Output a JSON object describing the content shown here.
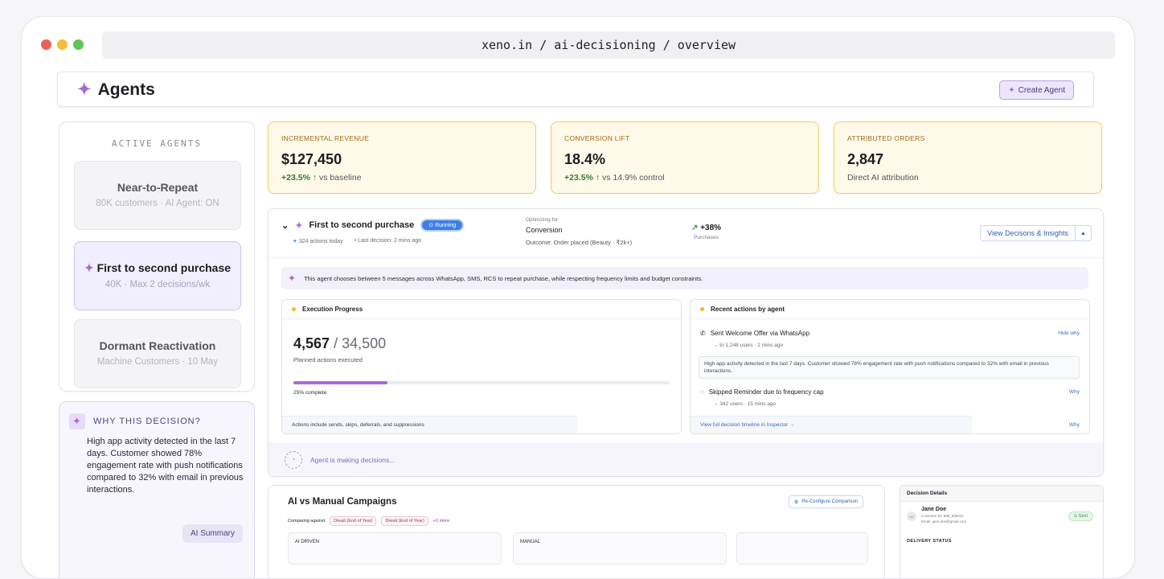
{
  "browser": {
    "url": "xeno.in / ai-decisioning / overview",
    "dots": [
      "#ec5f57",
      "#f5bd3a",
      "#5fc454"
    ]
  },
  "header": {
    "title": "Agents",
    "create_label": "Create Agent"
  },
  "sidebar": {
    "label": "ACTIVE AGENTS",
    "agents": [
      {
        "name": "Near-to-Repeat",
        "sub": "80K customers · AI Agent: ON"
      },
      {
        "name": "First to second purchase",
        "sub": "40K · Max 2 decisions/wk"
      },
      {
        "name": "Dormant Reactivation",
        "sub": "Machine Customers · 10 May"
      }
    ]
  },
  "why": {
    "title": "WHY THIS DECISION?",
    "text": "High app activity detected in the last 7 days. Customer showed 78% engagement rate with push notifications compared to 32% with email in previous interactions.",
    "summary_label": "AI Summary"
  },
  "metrics": [
    {
      "label": "INCREMENTAL REVENUE",
      "value": "$127,450",
      "change": "+23.5% ↑",
      "sub": "vs baseline"
    },
    {
      "label": "CONVERSION LIFT",
      "value": "18.4%",
      "change": "+23.5% ↑",
      "sub": "vs 14.9% control"
    },
    {
      "label": "ATTRIBUTED ORDERS",
      "value": "2,847",
      "change": "",
      "sub": "Direct AI attribution"
    }
  ],
  "agent": {
    "name": "First to second purchase",
    "status": "Running",
    "actions_today": "324 actions today",
    "last_decision": "Last decision: 2 mins ago",
    "optimizing_label": "Optimizing for",
    "optimizing_value": "Conversion",
    "outcome": "Outcome: Order placed (Beauty · ₹2k+)",
    "lift_value": "+38%",
    "lift_label": "Purchases",
    "view_label": "View Decisons & Insights",
    "banner": "This agent chooses between 5 messages across WhatsApp, SMS, RCS to repeat purchase, while respecting frequency limits and budget constraints."
  },
  "execution": {
    "title": "Execution Progress",
    "done": "4,567",
    "total": "/ 34,500",
    "sub": "Planned actions executed",
    "progress": 0.25,
    "pct_label": "25% complete",
    "footer": "Actions include sends, skips, deferrals, and suppressions"
  },
  "recent": {
    "title": "Recent actions by agent",
    "actions": [
      {
        "text": "Sent Welcome Offer via WhatsApp",
        "sub": "→ to 1,248 users · 2 mins ago",
        "link": "Hide why"
      },
      {
        "text": "Skipped Reminder due to frequency cap",
        "sub": "→ 342 users · 15 mins ago",
        "link": "Why"
      }
    ],
    "explain": "High app activity detected in the last 7 days. Customer showed 78% engagement rate with push notifications compared to 32% with email in previous interactions.",
    "timeline_link": "View full decision timeline in Inspector →",
    "footer_why": "Why"
  },
  "status_text": "Agent is making decisions...",
  "compare": {
    "title": "AI vs Manual Campaigns",
    "reconfigure": "Re-Configure Comparison",
    "against_label": "Comparing against",
    "tags": [
      "Diwali (End of Year)",
      "Diwali (End of Year)"
    ],
    "more": "+2 more",
    "col_ai": "AI DRIVEN",
    "col_manual": "MANUAL"
  },
  "details": {
    "title": "Decision Details",
    "name": "Jane Doe",
    "id": "Customer ID: 658_839011",
    "email": "Email: jane.doe@gmail.com",
    "sent": "Sent",
    "delivery": "DELIVERY STATUS"
  }
}
